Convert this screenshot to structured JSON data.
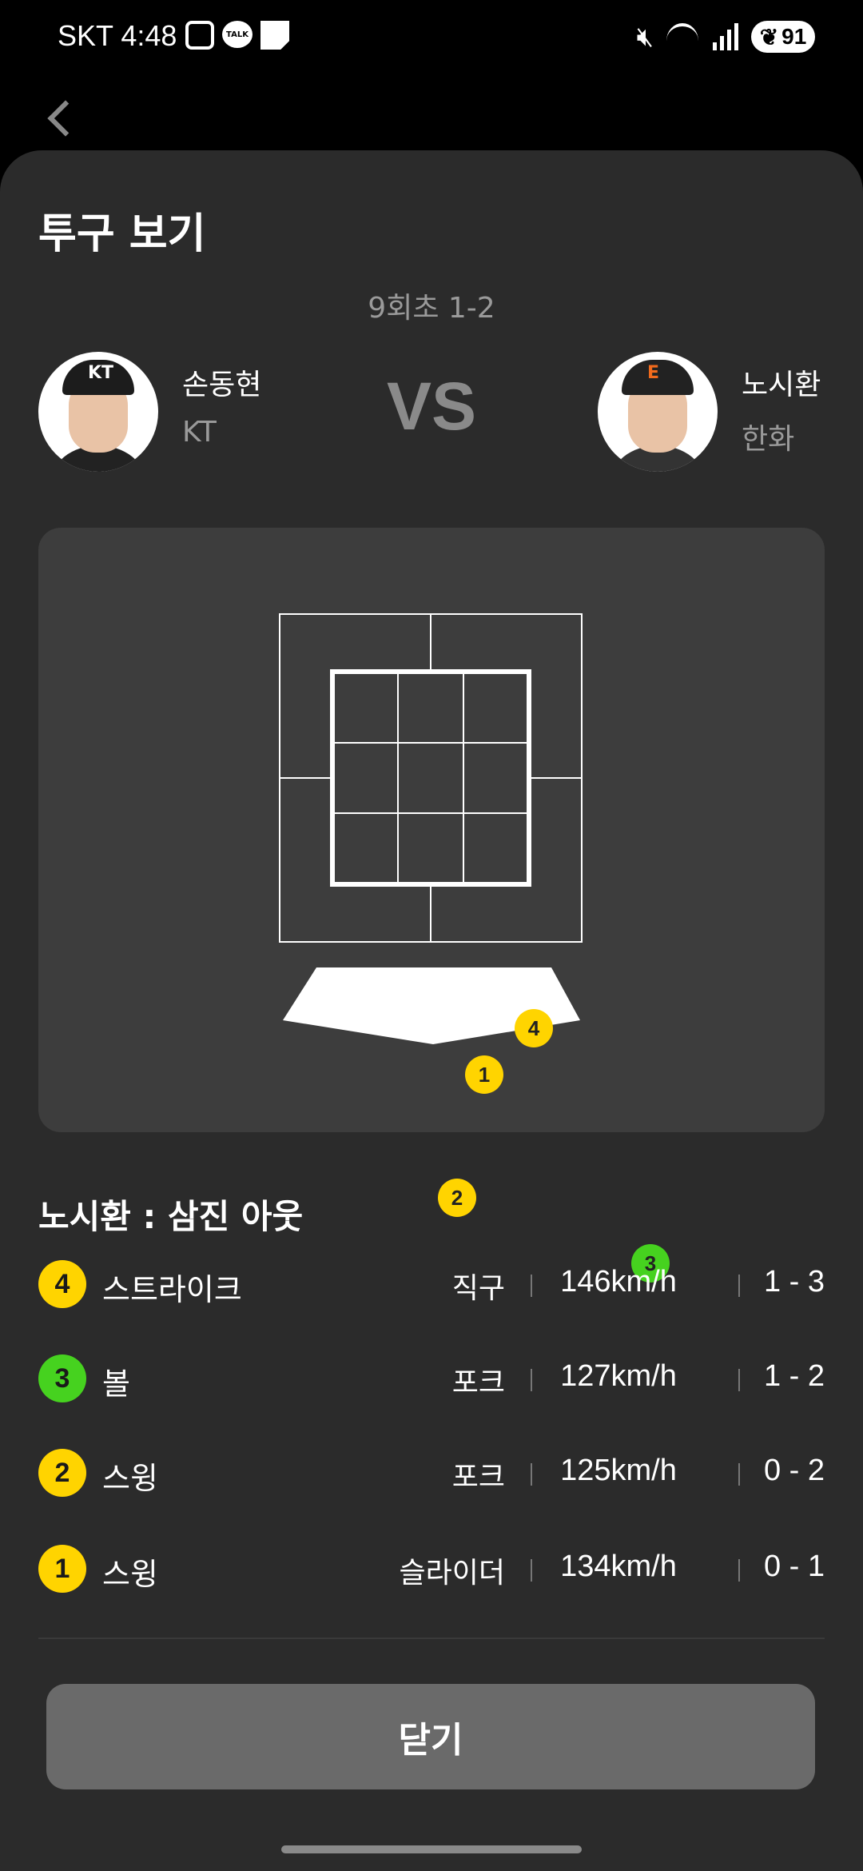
{
  "status_bar": {
    "carrier": "SKT",
    "time": "4:48",
    "talk_label": "TALK",
    "battery": "91"
  },
  "header": {
    "title": "투구 보기",
    "inning": "9회초 1-2"
  },
  "pitcher": {
    "name": "손동현",
    "team": "KT",
    "logo": "KT"
  },
  "vs_label": "VS",
  "batter": {
    "name": "노시환",
    "team": "한화",
    "logo": "E"
  },
  "strike_zone": {
    "pitches": [
      {
        "number": "4",
        "color": "#ffd400"
      },
      {
        "number": "1",
        "color": "#ffd400"
      },
      {
        "number": "2",
        "color": "#ffd400"
      },
      {
        "number": "3",
        "color": "#46d21f"
      }
    ]
  },
  "result": "노시환 : 삼진 아웃",
  "pitch_list": [
    {
      "number": "4",
      "label": "스트라이크",
      "pitch_type": "직구",
      "speed": "146km/h",
      "count": "1 - 3",
      "color": "#ffd400"
    },
    {
      "number": "3",
      "label": "볼",
      "pitch_type": "포크",
      "speed": "127km/h",
      "count": "1 - 2",
      "color": "#46d21f"
    },
    {
      "number": "2",
      "label": "스윙",
      "pitch_type": "포크",
      "speed": "125km/h",
      "count": "0 - 2",
      "color": "#ffd400"
    },
    {
      "number": "1",
      "label": "스윙",
      "pitch_type": "슬라이더",
      "speed": "134km/h",
      "count": "0 - 1",
      "color": "#ffd400"
    }
  ],
  "close_button": "닫기"
}
